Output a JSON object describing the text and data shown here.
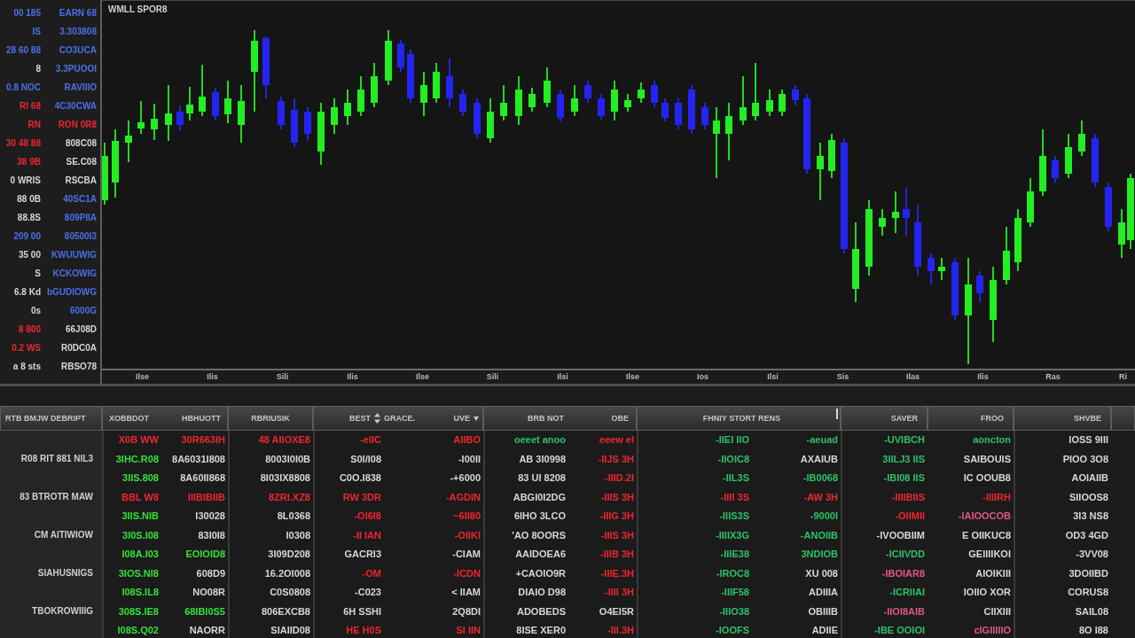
{
  "price_scale": {
    "rows": [
      {
        "left": {
          "text": "00 185",
          "color": "#4b6fe8"
        },
        "right": {
          "text": "EARN 68",
          "color": "#4b6fe8"
        }
      },
      {
        "left": {
          "text": "IS",
          "color": "#4b6fe8"
        },
        "right": {
          "text": "3.303808",
          "color": "#4b6fe8"
        }
      },
      {
        "left": {
          "text": "28 60 88",
          "color": "#4b6fe8"
        },
        "right": {
          "text": "CO3UCA",
          "color": "#4b6fe8"
        }
      },
      {
        "left": {
          "text": "8",
          "color": "#d6d6d6"
        },
        "right": {
          "text": "3.3PUOOI",
          "color": "#4b6fe8"
        }
      },
      {
        "left": {
          "text": "0.8 NOC",
          "color": "#4b6fe8"
        },
        "right": {
          "text": "RAVIIIO",
          "color": "#4b6fe8"
        }
      },
      {
        "left": {
          "text": "RI 68",
          "color": "#ee2630"
        },
        "right": {
          "text": "4C30CWA",
          "color": "#4b6fe8"
        }
      },
      {
        "left": {
          "text": "RN",
          "color": "#ee2630"
        },
        "right": {
          "text": "RON 0R8",
          "color": "#ee2630"
        }
      },
      {
        "left": {
          "text": "30 48 88",
          "color": "#ee2630"
        },
        "right": {
          "text": "808C08",
          "color": "#d6d6d6"
        }
      },
      {
        "left": {
          "text": "38 9B",
          "color": "#ee2630"
        },
        "right": {
          "text": "SE.C08",
          "color": "#d6d6d6"
        }
      },
      {
        "left": {
          "text": "0 WRIS",
          "color": "#d6d6d6"
        },
        "right": {
          "text": "RSCBA",
          "color": "#d6d6d6"
        }
      },
      {
        "left": {
          "text": "88 0B",
          "color": "#d6d6d6"
        },
        "right": {
          "text": "40SC1A",
          "color": "#4b6fe8"
        }
      },
      {
        "left": {
          "text": "88.8S",
          "color": "#d6d6d6"
        },
        "right": {
          "text": "809PIIA",
          "color": "#4b6fe8"
        }
      },
      {
        "left": {
          "text": "209 00",
          "color": "#4b6fe8"
        },
        "right": {
          "text": "80500I3",
          "color": "#4b6fe8"
        }
      },
      {
        "left": {
          "text": "35 00",
          "color": "#d6d6d6"
        },
        "right": {
          "text": "KWUUWIG",
          "color": "#4b6fe8"
        }
      },
      {
        "left": {
          "text": "S",
          "color": "#d6d6d6"
        },
        "right": {
          "text": "KCKOWIG",
          "color": "#4b6fe8"
        }
      },
      {
        "left": {
          "text": "6.8 Kd",
          "color": "#d6d6d6"
        },
        "right": {
          "text": "bGUDIOWG",
          "color": "#4b6fe8"
        }
      },
      {
        "left": {
          "text": "0s",
          "color": "#d6d6d6"
        },
        "right": {
          "text": "6000G",
          "color": "#4b6fe8"
        }
      },
      {
        "left": {
          "text": "8 800",
          "color": "#ee2630"
        },
        "right": {
          "text": "66J08D",
          "color": "#d6d6d6"
        }
      },
      {
        "left": {
          "text": "0.2 WS",
          "color": "#ee2630"
        },
        "right": {
          "text": "R0DC0A",
          "color": "#d6d6d6"
        }
      },
      {
        "left": {
          "text": "a 8 sts",
          "color": "#d6d6d6"
        },
        "right": {
          "text": "RBSO78",
          "color": "#d6d6d6"
        }
      }
    ]
  },
  "chart": {
    "title": "WMLL SPOR8",
    "x_labels": [
      "Ilse",
      "Ilis",
      "Sili",
      "Ilis",
      "Ilse",
      "Sili",
      "Ilsi",
      "Ilse",
      "Ios",
      "Ilsi",
      "Sis",
      "Ilas",
      "Ilis",
      "Ras",
      "Ri"
    ]
  },
  "table": {
    "label_column": {
      "title": "RTB BMJW DEBRIPT"
    },
    "columns": [
      {
        "titles": [
          "XOBBDOT"
        ],
        "sorted": false,
        "dropdown": false
      },
      {
        "titles": [
          "HBHUOTT"
        ],
        "sorted": false,
        "dropdown": false
      },
      {
        "titles": [
          "RBRIUSIK"
        ],
        "sorted": false,
        "dropdown": false
      },
      {
        "titles": [
          "BEST",
          "GRACE."
        ],
        "sorted": true,
        "dropdown": false
      },
      {
        "titles": [
          "UVE"
        ],
        "sorted": false,
        "dropdown": true
      },
      {
        "titles": [
          "BRB NOT"
        ],
        "sorted": false,
        "dropdown": false
      },
      {
        "titles": [
          "OBE"
        ],
        "sorted": false,
        "dropdown": false
      },
      {
        "titles": [
          "FHNIY STORT RENS"
        ],
        "sorted": false,
        "dropdown": false
      },
      {
        "sorted": false,
        "dropdown": false
      },
      {
        "titles": [
          "SAVER"
        ],
        "sorted": false,
        "dropdown": false
      },
      {
        "titles": [
          "FROO"
        ],
        "sorted": false,
        "dropdown": false
      },
      {
        "titles": [
          "SHVBE"
        ],
        "sorted": false,
        "dropdown": false
      }
    ],
    "rows": [
      {
        "cells": [
          {
            "text": "X0B WW",
            "color": "#ee2630"
          },
          {
            "text": "30R663IH",
            "color": "#ee2630"
          },
          {
            "text": "48 AIIOXE8",
            "color": "#ee2630"
          },
          {
            "text": "-eIIC",
            "color": "#ee2630"
          },
          {
            "text": "AIIBO",
            "color": "#ee2630"
          },
          {
            "text": "oeeet anoo",
            "color": "#2fc06a"
          },
          {
            "text": "eeew el",
            "color": "#ee2630"
          },
          {
            "text": "-IIEI IIO",
            "color": "#2fc06a"
          },
          {
            "text": "-aeuad",
            "color": "#2fc06a"
          },
          {
            "text": "-UVIBCH",
            "color": "#2fc06a"
          },
          {
            "text": "aoncton",
            "color": "#2fc06a"
          },
          {
            "text": "IOSS 9III",
            "color": "#d6d6d6"
          }
        ]
      },
      {
        "label": "R08 RIT 881 NIL3",
        "cells": [
          {
            "text": "3IHC.R08",
            "color": "#35e03a"
          },
          {
            "text": "8A6031I808",
            "color": "#d6d6d6"
          },
          {
            "text": "8003I0I0B",
            "color": "#d6d6d6"
          },
          {
            "text": "S0I/I08",
            "color": "#d6d6d6"
          },
          {
            "text": "-I00II",
            "color": "#d6d6d6"
          },
          {
            "text": "AB 3I0998",
            "color": "#d6d6d6"
          },
          {
            "text": "-IIJS 3H",
            "color": "#ee2630"
          },
          {
            "text": "-IIOIC8",
            "color": "#2fc06a"
          },
          {
            "text": "AXAIUB",
            "color": "#d6d6d6"
          },
          {
            "text": "3IILJ3 IIS",
            "color": "#2fc06a"
          },
          {
            "text": "SAIBOUIS",
            "color": "#d6d6d6"
          },
          {
            "text": "PIOO 3O8",
            "color": "#d6d6d6"
          }
        ]
      },
      {
        "cells": [
          {
            "text": "3IIS.808",
            "color": "#35e03a"
          },
          {
            "text": "8A60II868",
            "color": "#d6d6d6"
          },
          {
            "text": "8I03IX8808",
            "color": "#d6d6d6"
          },
          {
            "text": "C0O.I838",
            "color": "#d6d6d6"
          },
          {
            "text": "-+6000",
            "color": "#d6d6d6"
          },
          {
            "text": "83 UI 8208",
            "color": "#d6d6d6"
          },
          {
            "text": "-IIID.2I",
            "color": "#ee2630"
          },
          {
            "text": "-IIL3S",
            "color": "#2fc06a"
          },
          {
            "text": "-IB0068",
            "color": "#2fc06a"
          },
          {
            "text": "-IBI08 IIS",
            "color": "#2fc06a"
          },
          {
            "text": "IC OOUB8",
            "color": "#d6d6d6"
          },
          {
            "text": "AOIAIIB",
            "color": "#d6d6d6"
          }
        ]
      },
      {
        "label": "83 BTROTR MAW",
        "cells": [
          {
            "text": "BBL W8",
            "color": "#ee2630"
          },
          {
            "text": "IIIBIBIIB",
            "color": "#ee2630"
          },
          {
            "text": "8ZRI.XZ8",
            "color": "#ee2630"
          },
          {
            "text": "RW 3DR",
            "color": "#ee2630"
          },
          {
            "text": "-AGDIN",
            "color": "#ee2630"
          },
          {
            "text": "ABGI0I2DG",
            "color": "#d6d6d6"
          },
          {
            "text": "-IIIS 3H",
            "color": "#ee2630"
          },
          {
            "text": "-IIII 3S",
            "color": "#ee2630"
          },
          {
            "text": "-AW 3H",
            "color": "#ee2630"
          },
          {
            "text": "-IIIIBIIS",
            "color": "#ee2630"
          },
          {
            "text": "-IIIIRH",
            "color": "#ee2630"
          },
          {
            "text": "SIIOOS8",
            "color": "#d6d6d6"
          }
        ]
      },
      {
        "cells": [
          {
            "text": "3IIS.NIB",
            "color": "#35e03a"
          },
          {
            "text": "I30028",
            "color": "#d6d6d6"
          },
          {
            "text": "8L0368",
            "color": "#d6d6d6"
          },
          {
            "text": "-OI6I8",
            "color": "#ee2630"
          },
          {
            "text": "~6II80",
            "color": "#ee2630"
          },
          {
            "text": "6IHO 3LCO",
            "color": "#d6d6d6"
          },
          {
            "text": "-IIIG 3H",
            "color": "#ee2630"
          },
          {
            "text": "-IIIS3S",
            "color": "#2fc06a"
          },
          {
            "text": "-9000I",
            "color": "#2fc06a"
          },
          {
            "text": "-OIIMII",
            "color": "#ee2630"
          },
          {
            "text": "-IAIOOCOB",
            "color": "#e05a80"
          },
          {
            "text": "3I3 NS8",
            "color": "#d6d6d6"
          }
        ]
      },
      {
        "label": "CM AITIWIOW",
        "cells": [
          {
            "text": "3I0S.I08",
            "color": "#35e03a"
          },
          {
            "text": "83I0I8",
            "color": "#d6d6d6"
          },
          {
            "text": "I0308",
            "color": "#d6d6d6"
          },
          {
            "text": "-II IAN",
            "color": "#ee2630"
          },
          {
            "text": "-OIIKI",
            "color": "#ee2630"
          },
          {
            "text": "'AO 8OORS",
            "color": "#d6d6d6"
          },
          {
            "text": "-IIIS 3H",
            "color": "#ee2630"
          },
          {
            "text": "-IIIIX3G",
            "color": "#2fc06a"
          },
          {
            "text": "-ANOIIB",
            "color": "#2fc06a"
          },
          {
            "text": "-IVOOBIIM",
            "color": "#d6d6d6"
          },
          {
            "text": "E OIIKUC8",
            "color": "#d6d6d6"
          },
          {
            "text": "OD3 4GD",
            "color": "#d6d6d6"
          }
        ]
      },
      {
        "cells": [
          {
            "text": "I08A.I03",
            "color": "#35e03a"
          },
          {
            "text": "EOIOID8",
            "color": "#35e03a"
          },
          {
            "text": "3I09D208",
            "color": "#d6d6d6"
          },
          {
            "text": "GACRI3",
            "color": "#d6d6d6"
          },
          {
            "text": "-CIAM",
            "color": "#d6d6d6"
          },
          {
            "text": "AAIDOEA6",
            "color": "#d6d6d6"
          },
          {
            "text": "-IIIB 3H",
            "color": "#ee2630"
          },
          {
            "text": "-IIIE38",
            "color": "#2fc06a"
          },
          {
            "text": "3NDIOB",
            "color": "#2fc06a"
          },
          {
            "text": "-ICIIVDD",
            "color": "#2fc06a"
          },
          {
            "text": "GEIIIIKOI",
            "color": "#d6d6d6"
          },
          {
            "text": "-3VV08",
            "color": "#d6d6d6"
          }
        ]
      },
      {
        "label": "SIAHUSNIGS",
        "cells": [
          {
            "text": "3IOS.NI8",
            "color": "#35e03a"
          },
          {
            "text": "608D9",
            "color": "#d6d6d6"
          },
          {
            "text": "16.2OI008",
            "color": "#d6d6d6"
          },
          {
            "text": "-OM",
            "color": "#ee2630"
          },
          {
            "text": "-ICDN",
            "color": "#ee2630"
          },
          {
            "text": "+CAOIO9R",
            "color": "#d6d6d6"
          },
          {
            "text": "-IIIE.3H",
            "color": "#ee2630"
          },
          {
            "text": "-IROC8",
            "color": "#2fc06a"
          },
          {
            "text": "XU 008",
            "color": "#d6d6d6"
          },
          {
            "text": "-IBOIAR8",
            "color": "#e05a80"
          },
          {
            "text": "AIOIKIII",
            "color": "#d6d6d6"
          },
          {
            "text": "3DOIIBD",
            "color": "#d6d6d6"
          }
        ]
      },
      {
        "cells": [
          {
            "text": "I08S.IL8",
            "color": "#35e03a"
          },
          {
            "text": "NO08R",
            "color": "#d6d6d6"
          },
          {
            "text": "C0S0808",
            "color": "#d6d6d6"
          },
          {
            "text": "-C023",
            "color": "#d6d6d6"
          },
          {
            "text": "< IIAM",
            "color": "#d6d6d6"
          },
          {
            "text": "DIAIO D98",
            "color": "#d6d6d6"
          },
          {
            "text": "-IIII 3H",
            "color": "#ee2630"
          },
          {
            "text": "-IIIF58",
            "color": "#2fc06a"
          },
          {
            "text": "ADIIIA",
            "color": "#d6d6d6"
          },
          {
            "text": "-ICRIIAI",
            "color": "#2fc06a"
          },
          {
            "text": "IOIIO XOR",
            "color": "#d6d6d6"
          },
          {
            "text": "CORUS8",
            "color": "#d6d6d6"
          }
        ]
      },
      {
        "label": "TBOKROWIIIG",
        "cells": [
          {
            "text": "308S.IE8",
            "color": "#35e03a"
          },
          {
            "text": "68IBI0S5",
            "color": "#35e03a"
          },
          {
            "text": "806EXCB8",
            "color": "#d6d6d6"
          },
          {
            "text": "6H SSHI",
            "color": "#d6d6d6"
          },
          {
            "text": "2Q8DI",
            "color": "#d6d6d6"
          },
          {
            "text": "ADOBEDS",
            "color": "#d6d6d6"
          },
          {
            "text": "O4EI5R",
            "color": "#d6d6d6"
          },
          {
            "text": "-IIIO38",
            "color": "#2fc06a"
          },
          {
            "text": "OBIIIB",
            "color": "#d6d6d6"
          },
          {
            "text": "-IIOI8AIB",
            "color": "#e05a80"
          },
          {
            "text": "CIIXIII",
            "color": "#d6d6d6"
          },
          {
            "text": "SAIL08",
            "color": "#d6d6d6"
          }
        ]
      },
      {
        "cells": [
          {
            "text": "I08S.Q02",
            "color": "#35e03a"
          },
          {
            "text": "NAORR",
            "color": "#d6d6d6"
          },
          {
            "text": "SIAIID08",
            "color": "#d6d6d6"
          },
          {
            "text": "HE H0S",
            "color": "#ee2630"
          },
          {
            "text": "SI IIN",
            "color": "#ee2630"
          },
          {
            "text": "8ISE XER0",
            "color": "#d6d6d6"
          },
          {
            "text": "-III.3H",
            "color": "#ee2630"
          },
          {
            "text": "-IOOFS",
            "color": "#2fc06a"
          },
          {
            "text": "ADIIE",
            "color": "#d6d6d6"
          },
          {
            "text": "-IBE OOIOI",
            "color": "#2fc06a"
          },
          {
            "text": "cIGIIIIIO",
            "color": "#e05a80"
          },
          {
            "text": "8O I88",
            "color": "#d6d6d6"
          }
        ]
      }
    ]
  }
}
